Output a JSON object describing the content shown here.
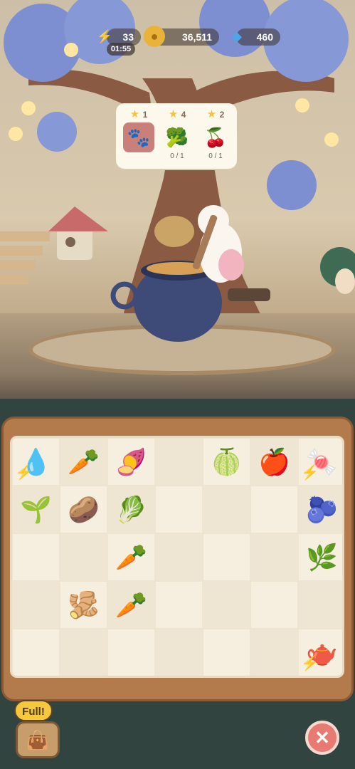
{
  "hud": {
    "energy": "33",
    "energy_timer": "01:55",
    "coins": "36,511",
    "gems": "460"
  },
  "order": {
    "slots": [
      {
        "stars": "1",
        "item": "paw-print-plate",
        "progress": ""
      },
      {
        "stars": "4",
        "item": "broccoli",
        "progress": "0 / 1"
      },
      {
        "stars": "2",
        "item": "cherries",
        "progress": "0 / 1"
      }
    ]
  },
  "board": {
    "columns": 7,
    "rows": 5,
    "items": [
      {
        "name": "water-well-generator",
        "glyph": "💧",
        "boosted": true
      },
      {
        "name": "parsnip",
        "glyph": "🥕"
      },
      {
        "name": "beet",
        "glyph": "🍠"
      },
      {
        "name": "lime",
        "glyph": "🍈"
      },
      {
        "name": "apple",
        "glyph": "🍎"
      },
      {
        "name": "gumball-generator",
        "glyph": "🍬",
        "boosted": true
      },
      {
        "name": "seedling",
        "glyph": "🌱"
      },
      {
        "name": "potato",
        "glyph": "🥔"
      },
      {
        "name": "daikon",
        "glyph": "🥬"
      },
      {
        "name": "blueberry",
        "glyph": "🫐"
      },
      {
        "name": "parsnip",
        "glyph": "🥕"
      },
      {
        "name": "sprout-bulb",
        "glyph": "🌿"
      },
      {
        "name": "ginger",
        "glyph": "🫚"
      },
      {
        "name": "carrot",
        "glyph": "🥕"
      },
      {
        "name": "teapot-generator",
        "glyph": "🫖",
        "boosted": true
      }
    ]
  },
  "footer": {
    "full_label": "Full!",
    "close_glyph": "✕"
  },
  "colors": {
    "bolt": "#f2b21d",
    "star": "#f3c23e",
    "close": "#e77a72"
  }
}
